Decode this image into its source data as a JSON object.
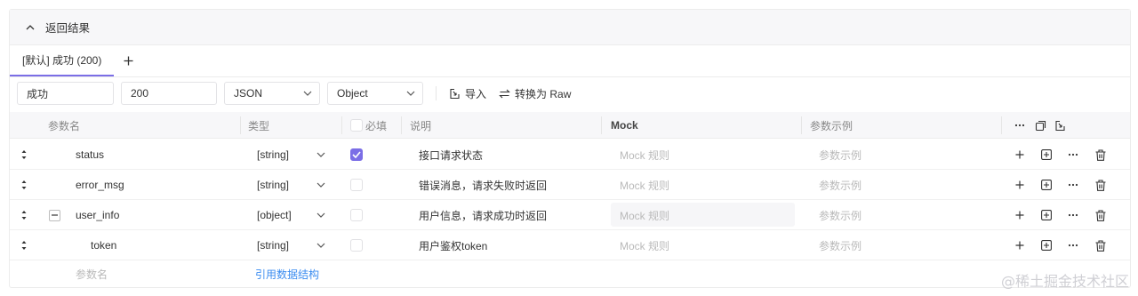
{
  "section": {
    "title": "返回结果"
  },
  "tabs": [
    {
      "label": "[默认] 成功 (200)"
    }
  ],
  "controls": {
    "name_value": "成功",
    "code_value": "200",
    "format_value": "JSON",
    "type_value": "Object",
    "import_label": "导入",
    "convert_label": "转换为 Raw"
  },
  "table": {
    "headers": {
      "name": "参数名",
      "type": "类型",
      "required": "必填",
      "desc": "说明",
      "mock": "Mock",
      "example": "参数示例"
    },
    "rows": [
      {
        "name": "status",
        "type": "[string]",
        "required": true,
        "desc": "接口请求状态",
        "mock_placeholder": "Mock 规则",
        "example_placeholder": "参数示例"
      },
      {
        "name": "error_msg",
        "type": "[string]",
        "required": false,
        "desc": "错误消息，请求失败时返回",
        "mock_placeholder": "Mock 规则",
        "example_placeholder": "参数示例"
      },
      {
        "name": "user_info",
        "type": "[object]",
        "required": false,
        "desc": "用户信息，请求成功时返回",
        "mock_placeholder": "Mock 规则",
        "example_placeholder": "参数示例"
      },
      {
        "name": "token",
        "type": "[string]",
        "required": false,
        "desc": "用户鉴权token",
        "mock_placeholder": "Mock 规则",
        "example_placeholder": "参数示例"
      }
    ],
    "footer": {
      "name_placeholder": "参数名",
      "ref_link": "引用数据结构"
    }
  },
  "watermark": "@稀土掘金技术社区",
  "colors": {
    "accent": "#7b6ee6",
    "link": "#3b8cf0"
  }
}
